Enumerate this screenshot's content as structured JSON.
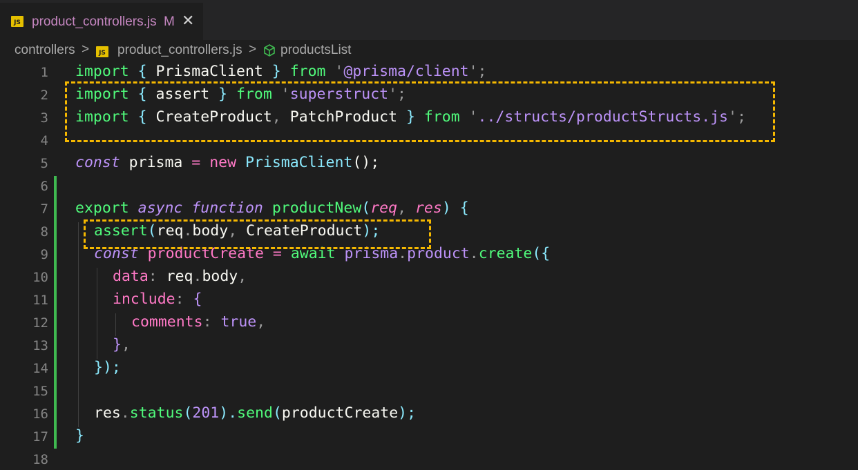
{
  "tab": {
    "icon": "js-file-icon",
    "icon_text": "JS",
    "filename": "product_controllers.js",
    "modified": "M",
    "close": "✕"
  },
  "breadcrumb": {
    "folder": "controllers",
    "sep1": ">",
    "file": "product_controllers.js",
    "sep2": ">",
    "symbol_icon": "cube-icon",
    "symbol": "productsList"
  },
  "line_numbers": [
    "1",
    "2",
    "3",
    "4",
    "5",
    "6",
    "7",
    "8",
    "9",
    "10",
    "11",
    "12",
    "13",
    "14",
    "15",
    "16",
    "17",
    "18"
  ],
  "code": {
    "l1": {
      "a": "import",
      "b": " { ",
      "c": "PrismaClient",
      "d": " } ",
      "e": "from",
      "f": " '",
      "g": "@prisma/client",
      "h": "'",
      "i": ";"
    },
    "l2": {
      "a": "import",
      "b": " { ",
      "c": "assert",
      "d": " } ",
      "e": "from",
      "f": " '",
      "g": "superstruct",
      "h": "'",
      "i": ";"
    },
    "l3": {
      "a": "import",
      "b": " { ",
      "c": "CreateProduct",
      "c2": ",",
      "c3": " PatchProduct",
      "d": " } ",
      "e": "from",
      "f": " '",
      "g": "../structs/productStructs.js",
      "h": "'",
      "i": ";"
    },
    "l5": {
      "a": "const",
      "b": " prisma ",
      "c": "=",
      "d": " ",
      "e": "new",
      "f": " ",
      "g": "PrismaClient",
      "h": "();"
    },
    "l7": {
      "a": "export",
      "b": " ",
      "c": "async",
      "d": " ",
      "e": "function",
      "f": " ",
      "g": "productNew",
      "h": "(",
      "i": "req",
      "j": ", ",
      "k": "res",
      "l": ") {"
    },
    "l8": {
      "a": "assert",
      "b": "(",
      "c": "req",
      "d": ".",
      "e": "body",
      "f": ", ",
      "g": "CreateProduct",
      "h": ");"
    },
    "l9": {
      "a": "const",
      "b": " productCreate ",
      "c": "=",
      "d": " ",
      "e": "await",
      "f": " ",
      "g": "prisma",
      "h": ".",
      "i": "product",
      "j": ".",
      "k": "create",
      "l": "({"
    },
    "l10": {
      "a": "data",
      "b": ": ",
      "c": "req",
      "d": ".",
      "e": "body",
      "f": ","
    },
    "l11": {
      "a": "include",
      "b": ": ",
      "c": "{"
    },
    "l12": {
      "a": "comments",
      "b": ": ",
      "c": "true",
      "d": ","
    },
    "l13": {
      "a": "}",
      "b": ","
    },
    "l14": {
      "a": "});"
    },
    "l16": {
      "a": "res",
      "b": ".",
      "c": "status",
      "d": "(",
      "e": "201",
      "f": ").",
      "g": "send",
      "h": "(",
      "i": "productCreate",
      "j": ");"
    },
    "l17": {
      "a": "}"
    }
  },
  "colors": {
    "highlight_box": "#f5b800",
    "git_added": "#3fb950",
    "background": "#1e1e1e"
  }
}
